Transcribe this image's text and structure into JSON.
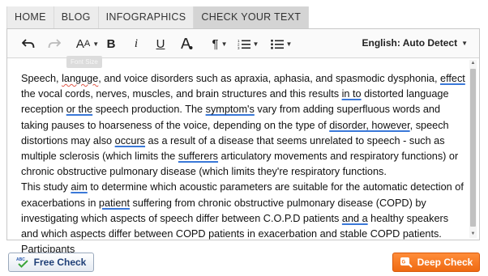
{
  "nav": {
    "items": [
      {
        "label": "HOME"
      },
      {
        "label": "BLOG"
      },
      {
        "label": "INFOGRAPHICS"
      },
      {
        "label": "CHECK YOUR TEXT"
      }
    ],
    "active": "CHECK YOUR TEXT"
  },
  "toolbar": {
    "font_size_label": "AA",
    "bold": "B",
    "italic": "i",
    "underline": "U",
    "language": "English: Auto Detect",
    "tooltip": "Font Size",
    "icons": [
      "undo-icon",
      "redo-icon",
      "font-size-icon",
      "bold-icon",
      "italic-icon",
      "underline-icon",
      "text-color-icon",
      "paragraph-icon",
      "numbered-list-icon",
      "bulleted-list-icon"
    ]
  },
  "content": {
    "p1": [
      {
        "t": "Speech, "
      },
      {
        "t": "languge",
        "mark": "err-r"
      },
      {
        "t": ", and voice disorders such as apraxia, aphasia, and spasmodic dysphonia, "
      },
      {
        "t": "effect",
        "mark": "err-b"
      },
      {
        "t": " the vocal cords, nerves, muscles, and brain structures and this results "
      },
      {
        "t": "in to",
        "mark": "err-b"
      },
      {
        "t": " distorted language reception "
      },
      {
        "t": "or the",
        "mark": "err-b"
      },
      {
        "t": " speech production. The "
      },
      {
        "t": "symptom's",
        "mark": "err-b"
      },
      {
        "t": " vary from adding superfluous words and taking pauses to hoarseness of the voice, depending on the type of "
      },
      {
        "t": "disorder, however",
        "mark": "err-b"
      },
      {
        "t": ", speech distortions may also "
      },
      {
        "t": "occurs",
        "mark": "err-b"
      },
      {
        "t": " as a result of a disease that seems unrelated to speech - such as multiple sclerosis (which limits the "
      },
      {
        "t": "sufferers",
        "mark": "err-b"
      },
      {
        "t": " articulatory movements and respiratory functions) or chronic obstructive pulmonary disease (which limits they're respiratory functions."
      }
    ],
    "p2": [
      {
        "t": "This study "
      },
      {
        "t": "aim",
        "mark": "err-b"
      },
      {
        "t": " to determine which acoustic parameters are suitable for the automatic detection of exacerbations in "
      },
      {
        "t": "patient",
        "mark": "err-b"
      },
      {
        "t": " suffering from chronic obstructive pulmonary disease (COPD) by investigating which aspects of speech differ between C.O.P.D patients "
      },
      {
        "t": "and a",
        "mark": "err-b"
      },
      {
        "t": " healthy speakers and which aspects differ between COPD patients in exacerbation and stable COPD patients. Participants"
      }
    ]
  },
  "buttons": {
    "free_check": "Free Check",
    "deep_check": "Deep Check"
  },
  "colors": {
    "error_spelling": "#e05a4a",
    "error_grammar": "#3a78d8",
    "deep_check_bg": "#ef6a12",
    "free_check_text": "#1f3f77"
  }
}
